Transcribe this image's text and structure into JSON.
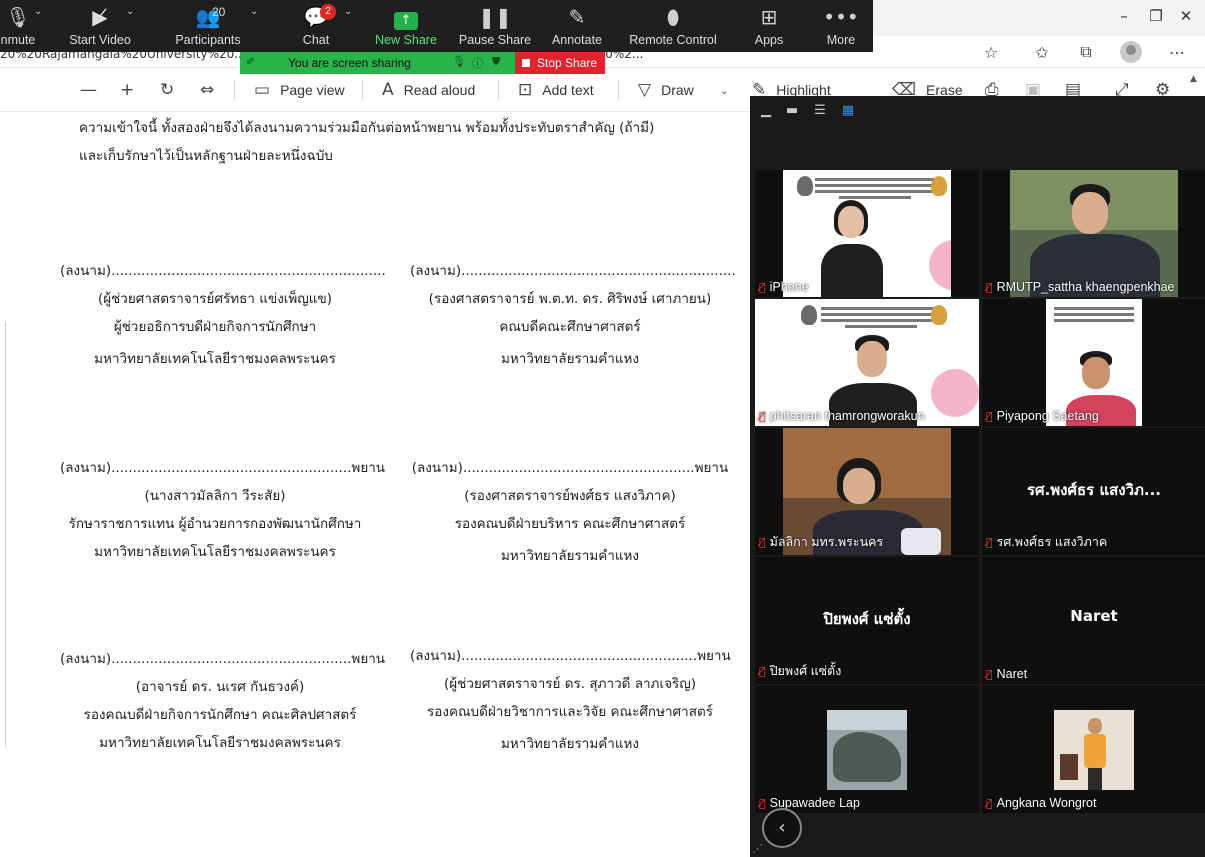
{
  "browser": {
    "address_text": "20%20Rajamangala%20University%20...  ...ข้อตกลง(พิมพ์ใส่ตราสัญลักษณ์)%202565/MOU%20ฉบับที่%2020%2...",
    "window_controls": [
      "–",
      "❐",
      "✕"
    ],
    "addr_icons": [
      "star-icon",
      "favorites-icon",
      "collections-icon",
      "profile-icon",
      "more-icon"
    ]
  },
  "pdf_toolbar": {
    "page_view": "Page view",
    "read_aloud": "Read aloud",
    "add_text": "Add text",
    "draw": "Draw",
    "highlight": "Highlight",
    "erase": "Erase"
  },
  "zoom_bar": {
    "unmute": "nmute",
    "start_video": "Start Video",
    "participants": "Participants",
    "participants_count": "20",
    "chat": "Chat",
    "chat_badge": "2",
    "new_share": "New Share",
    "pause_share": "Pause Share",
    "annotate": "Annotate",
    "remote_control": "Remote Control",
    "apps": "Apps",
    "more": "More"
  },
  "share_banner": {
    "text": "You are screen sharing",
    "stop": "Stop Share"
  },
  "document": {
    "intro_line1": "ความเข้าใจนี้ ทั้งสองฝ่ายจึงได้ลงนามความร่วมมือกันต่อหน้าพยาน พร้อมทั้งประทับตราสำคัญ (ถ้ามี)",
    "intro_line2": "และเก็บรักษาไว้เป็นหลักฐานฝ่ายละหนึ่งฉบับ",
    "signatures": [
      [
        "(ลงนาม)................................................................",
        "(ผู้ช่วยศาสตราจารย์ศรัทธา แข่งเพ็ญแข)",
        "ผู้ช่วยอธิการบดีฝ่ายกิจการนักศึกษา",
        "มหาวิทยาลัยเทคโนโลยีราชมงคลพระนคร"
      ],
      [
        "(ลงนาม)................................................................",
        "(รองศาสตราจารย์ พ.ต.ท. ดร. ศิริพงษ์ เศาภายน)",
        "คณบดีคณะศึกษาศาสตร์",
        "มหาวิทยาลัยรามคำแหง"
      ],
      [
        "(ลงนาม)........................................................พยาน",
        "(นางสาวมัลลิกา วีระสัย)",
        "รักษาราชการแทน ผู้อำนวยการกองพัฒนานักศึกษา",
        "มหาวิทยาลัยเทคโนโลยีราชมงคลพระนคร"
      ],
      [
        "(ลงนาม)......................................................พยาน",
        "(รองศาสตราจารย์พงศ์ธร แสงวิภาค)",
        "รองคณบดีฝ่ายบริหาร คณะศึกษาศาสตร์",
        "มหาวิทยาลัยรามคำแหง"
      ],
      [
        "(ลงนาม)........................................................พยาน",
        "(อาจารย์ ดร. นเรศ กันธวงค์)",
        "รองคณบดีฝ่ายกิจการนักศึกษา คณะศิลปศาสตร์",
        "มหาวิทยาลัยเทคโนโลยีราชมงคลพระนคร"
      ],
      [
        "(ลงนาม).......................................................พยาน",
        "(ผู้ช่วยศาสตราจารย์ ดร. สุภาวดี ลาภเจริญ)",
        "รองคณบดีฝ่ายวิชาการและวิจัย คณะศึกษาศาสตร์",
        "มหาวิทยาลัยรามคำแหง"
      ]
    ]
  },
  "gallery": {
    "participants": [
      {
        "name": "iPhone",
        "big": ""
      },
      {
        "name": "RMUTP_sattha khaengpenkhae",
        "big": ""
      },
      {
        "name": "phitsaran thamrongworakun",
        "big": ""
      },
      {
        "name": "Piyapong Saetang",
        "big": ""
      },
      {
        "name": "มัลลิกา มทร.พระนคร",
        "big": ""
      },
      {
        "name": "รศ.พงศ์ธร แสงวิภาค",
        "big": "รศ.พงศ์ธร แสงวิภ..."
      },
      {
        "name": "ปิยพงศ์ แซ่ตั้ง",
        "big": "ปิยพงศ์ แซ่ตั้ง"
      },
      {
        "name": "Naret",
        "big": "Naret"
      },
      {
        "name": "Supawadee Lap",
        "big": ""
      },
      {
        "name": "Angkana Wongrot",
        "big": ""
      }
    ]
  },
  "colors": {
    "zoom_bar_bg": "#1f1f1f",
    "share_green": "#2ab24b",
    "stop_red": "#e0242e",
    "mic_off_red": "#ff3a3a"
  }
}
